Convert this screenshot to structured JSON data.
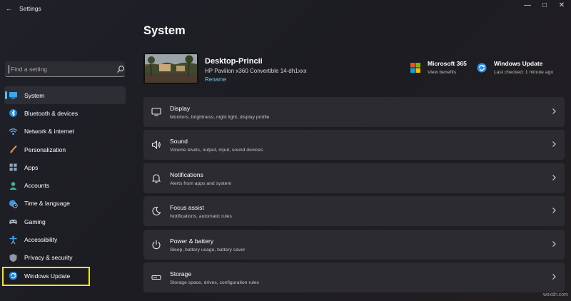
{
  "window": {
    "title": "Settings",
    "controls": {
      "minimize": "—",
      "maximize": "□",
      "close": "✕"
    }
  },
  "search": {
    "placeholder": "Find a setting"
  },
  "sidebar": {
    "items": [
      {
        "label": "System",
        "icon": "monitor-icon",
        "selected": true
      },
      {
        "label": "Bluetooth & devices",
        "icon": "bluetooth-icon"
      },
      {
        "label": "Network & internet",
        "icon": "wifi-icon"
      },
      {
        "label": "Personalization",
        "icon": "brush-icon"
      },
      {
        "label": "Apps",
        "icon": "apps-icon"
      },
      {
        "label": "Accounts",
        "icon": "person-icon"
      },
      {
        "label": "Time & language",
        "icon": "globe-clock-icon"
      },
      {
        "label": "Gaming",
        "icon": "gamepad-icon"
      },
      {
        "label": "Accessibility",
        "icon": "accessibility-icon"
      },
      {
        "label": "Privacy & security",
        "icon": "shield-icon"
      },
      {
        "label": "Windows Update",
        "icon": "sync-icon"
      }
    ]
  },
  "main": {
    "title": "System",
    "device": {
      "name": "Desktop-Princii",
      "model": "HP Pavilion x360 Convertible 14-dh1xxx",
      "rename_label": "Rename"
    },
    "promos": [
      {
        "title": "Microsoft 365",
        "subtitle": "View benefits",
        "icon": "microsoft-logo-icon"
      },
      {
        "title": "Windows Update",
        "subtitle": "Last checked: 1 minute ago",
        "icon": "windows-update-icon"
      }
    ],
    "cards": [
      {
        "title": "Display",
        "subtitle": "Monitors, brightness, night light, display profile",
        "icon": "display-icon"
      },
      {
        "title": "Sound",
        "subtitle": "Volume levels, output, input, sound devices",
        "icon": "speaker-icon"
      },
      {
        "title": "Notifications",
        "subtitle": "Alerts from apps and system",
        "icon": "bell-icon"
      },
      {
        "title": "Focus assist",
        "subtitle": "Notifications, automatic rules",
        "icon": "moon-icon"
      },
      {
        "title": "Power & battery",
        "subtitle": "Sleep, battery usage, battery saver",
        "icon": "power-icon"
      },
      {
        "title": "Storage",
        "subtitle": "Storage space, drives, configuration rules",
        "icon": "storage-icon"
      }
    ]
  },
  "watermark": "wsxdn.com",
  "colors": {
    "accent": "#4cc2ff",
    "highlight": "#f4ea12",
    "card": "#2b2b31"
  }
}
